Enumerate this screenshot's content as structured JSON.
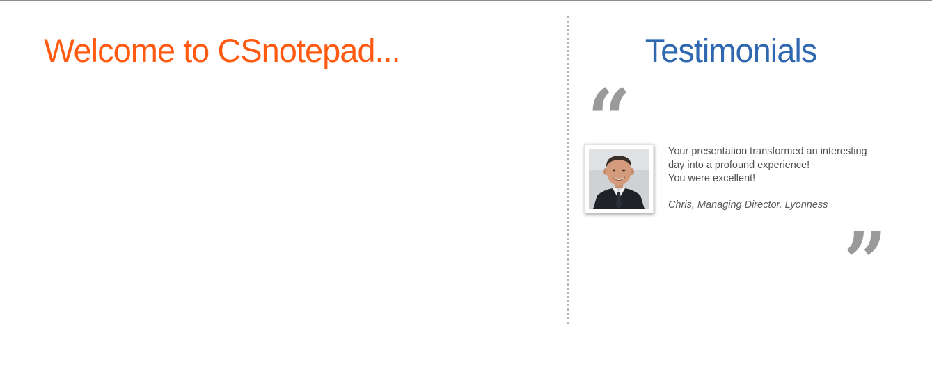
{
  "welcome": {
    "title": "Welcome to CSnotepad..."
  },
  "testimonials": {
    "title": "Testimonials",
    "quote_open_glyph": "“",
    "quote_close_glyph": "”",
    "items": [
      {
        "lines": [
          "Your presentation transformed an interesting",
          "day into a profound experience!",
          "You were excellent!"
        ],
        "author": "Chris, Managing Director, Lyonness",
        "photo_icon": "person-photo"
      }
    ]
  },
  "colors": {
    "welcome_title": "#ff5a0f",
    "testimonials_title": "#2f68b0",
    "quote_marks": "#9a9a9a",
    "body_text": "#505050"
  }
}
